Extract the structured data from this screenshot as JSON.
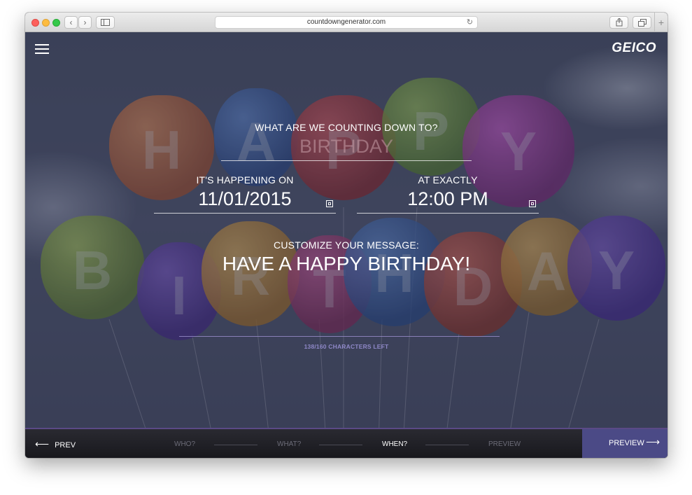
{
  "browser": {
    "url": "countdowngenerator.com",
    "back_icon": "‹",
    "forward_icon": "›"
  },
  "header": {
    "logo": "GEICO"
  },
  "balloons": {
    "top_letters": [
      "H",
      "A",
      "P",
      "P",
      "Y"
    ],
    "bottom_letters": [
      "B",
      "I",
      "R",
      "T",
      "H",
      "D",
      "A",
      "Y"
    ]
  },
  "form": {
    "event_label": "WHAT ARE WE COUNTING DOWN TO?",
    "event_value": "BIRTHDAY",
    "date_label": "IT'S HAPPENING ON",
    "date_value": "11/01/2015",
    "time_label": "AT EXACTLY",
    "time_value": "12:00 PM",
    "message_label": "CUSTOMIZE YOUR MESSAGE:",
    "message_value": "HAVE A HAPPY BIRTHDAY!",
    "chars_left": "138/160 CHARACTERS LEFT"
  },
  "footer": {
    "prev_label": "PREV",
    "steps": [
      "WHO?",
      "WHAT?",
      "WHEN?",
      "PREVIEW"
    ],
    "active_step": "WHEN?",
    "preview_label": "PREVIEW"
  },
  "colors": {
    "accent": "#4b4a86",
    "balloon_palette": [
      "#c8622a",
      "#2e5ea8",
      "#b32a2a",
      "#6f9a2c",
      "#9a2a8e",
      "#7a9a2a",
      "#5a2fa0",
      "#c78a1c",
      "#a1245e",
      "#2d5aa8",
      "#b4341f",
      "#c89222",
      "#5a2a9e"
    ]
  }
}
